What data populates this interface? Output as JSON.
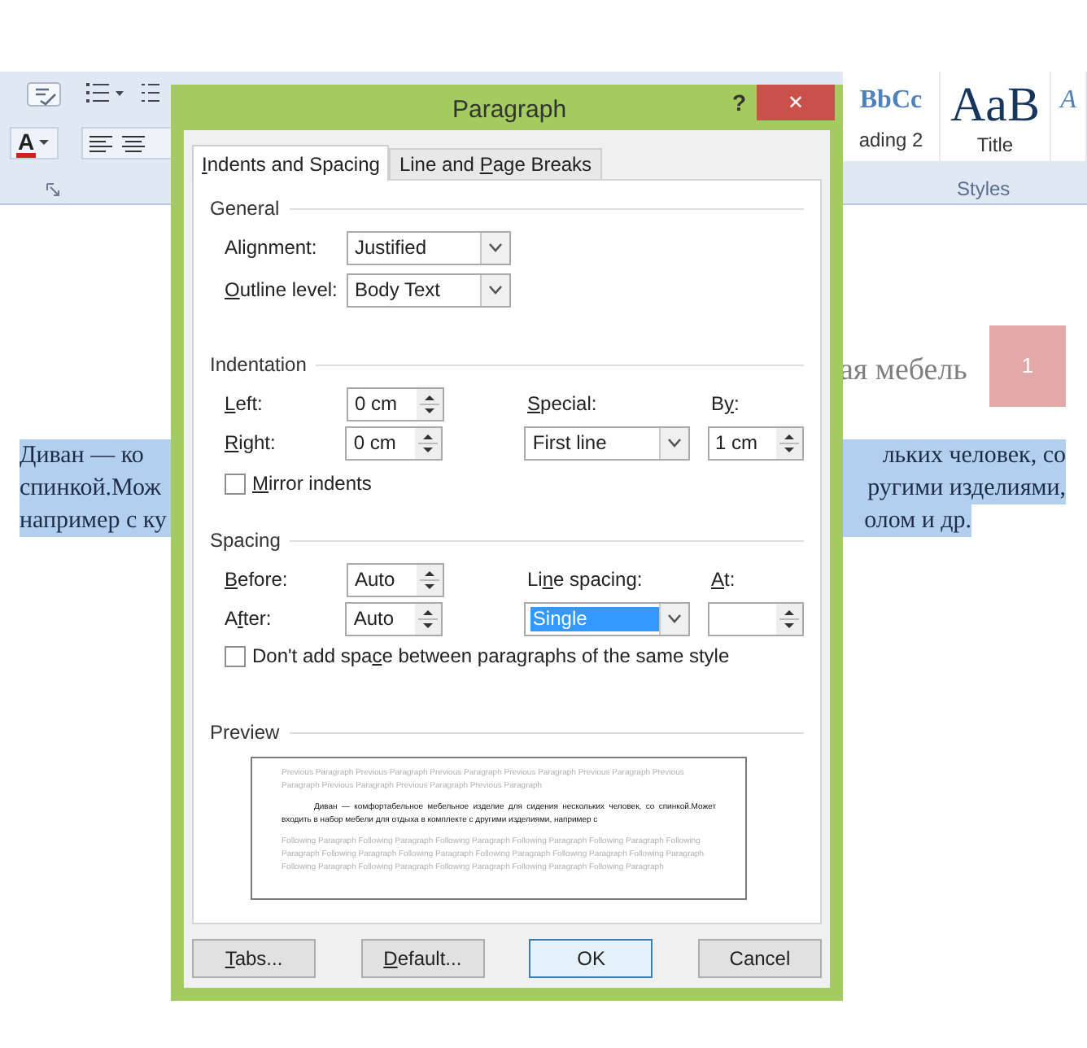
{
  "ribbon": {
    "font_color_letter": "A",
    "styles": [
      {
        "sample": "BbCc",
        "name": "ading 2",
        "kind": "heading"
      },
      {
        "sample": "AaB",
        "name": "Title",
        "kind": "title"
      },
      {
        "sample": "A",
        "kind": "subtitle"
      }
    ],
    "group_label": "Styles"
  },
  "document": {
    "heading": "ая мебель",
    "page_number": "1",
    "selected": true,
    "lines": [
      {
        "left": "Диван — ко",
        "right": "льких человек, со"
      },
      {
        "left": "спинкой.Мож",
        "right": "ругими изделиями,"
      },
      {
        "left": "например с ку",
        "right": "олом и др."
      }
    ]
  },
  "dialog": {
    "title": "Paragraph",
    "help": "?",
    "close": "✕",
    "tabs": [
      {
        "label": {
          "key": "I",
          "after": "ndents and Spacing"
        },
        "selected": true
      },
      {
        "label": {
          "before": "Line and ",
          "key": "P",
          "after": "age Breaks"
        },
        "selected": false
      }
    ],
    "general": {
      "heading": "General",
      "fields": [
        {
          "label": {
            "before": "Ali",
            "key": "g",
            "after": "nment:"
          },
          "value": "Justified"
        },
        {
          "label": {
            "key": "O",
            "after": "utline level:"
          },
          "value": "Body Text"
        }
      ]
    },
    "indentation": {
      "heading": "Indentation",
      "left": {
        "label": {
          "key": "L",
          "after": "eft:"
        },
        "value": "0 cm"
      },
      "right": {
        "label": {
          "key": "R",
          "after": "ight:"
        },
        "value": "0 cm"
      },
      "special": {
        "label": {
          "key": "S",
          "after": "pecial:"
        },
        "value": "First line"
      },
      "by": {
        "label": {
          "before": "B",
          "key": "y",
          "after": ":"
        },
        "value": "1 cm"
      },
      "mirror": {
        "label": {
          "key": "M",
          "after": "irror indents"
        },
        "checked": false
      }
    },
    "spacing": {
      "heading": "Spacing",
      "before": {
        "label": {
          "key": "B",
          "after": "efore:"
        },
        "value": "Auto"
      },
      "after": {
        "label": {
          "before": "A",
          "key": "f",
          "after": "ter:"
        },
        "value": "Auto"
      },
      "line_spacing": {
        "label": {
          "before": "Li",
          "key": "n",
          "after": "e spacing:"
        },
        "value": "Single",
        "selected": true
      },
      "at": {
        "label": {
          "key": "A",
          "after": "t:"
        }
      },
      "no_space": {
        "label": {
          "before": "Don't add spa",
          "key": "c",
          "after": "e between paragraphs of the same style"
        },
        "checked": false
      }
    },
    "preview": {
      "heading": "Preview",
      "previous": "Previous Paragraph Previous Paragraph Previous Paragraph Previous Paragraph Previous Paragraph Previous Paragraph Previous Paragraph Previous Paragraph Previous Paragraph",
      "sample": "Диван — комфортабельное мебельное изделие для сидения нескольких человек, со спинкой.Может входить в набор мебели для отдыха в комплекте с другими изделиями, например с",
      "following": "Following Paragraph Following Paragraph Following Paragraph Following Paragraph Following Paragraph Following Paragraph Following Paragraph Following Paragraph Following Paragraph Following Paragraph Following Paragraph Following Paragraph Following Paragraph Following Paragraph Following Paragraph Following Paragraph"
    },
    "buttons": [
      {
        "label": {
          "key": "T",
          "after": "abs..."
        },
        "default": false
      },
      {
        "label": {
          "key": "D",
          "after": "efault..."
        },
        "default": false
      },
      {
        "label": "OK",
        "default": true
      },
      {
        "label": "Cancel",
        "default": false
      }
    ]
  }
}
